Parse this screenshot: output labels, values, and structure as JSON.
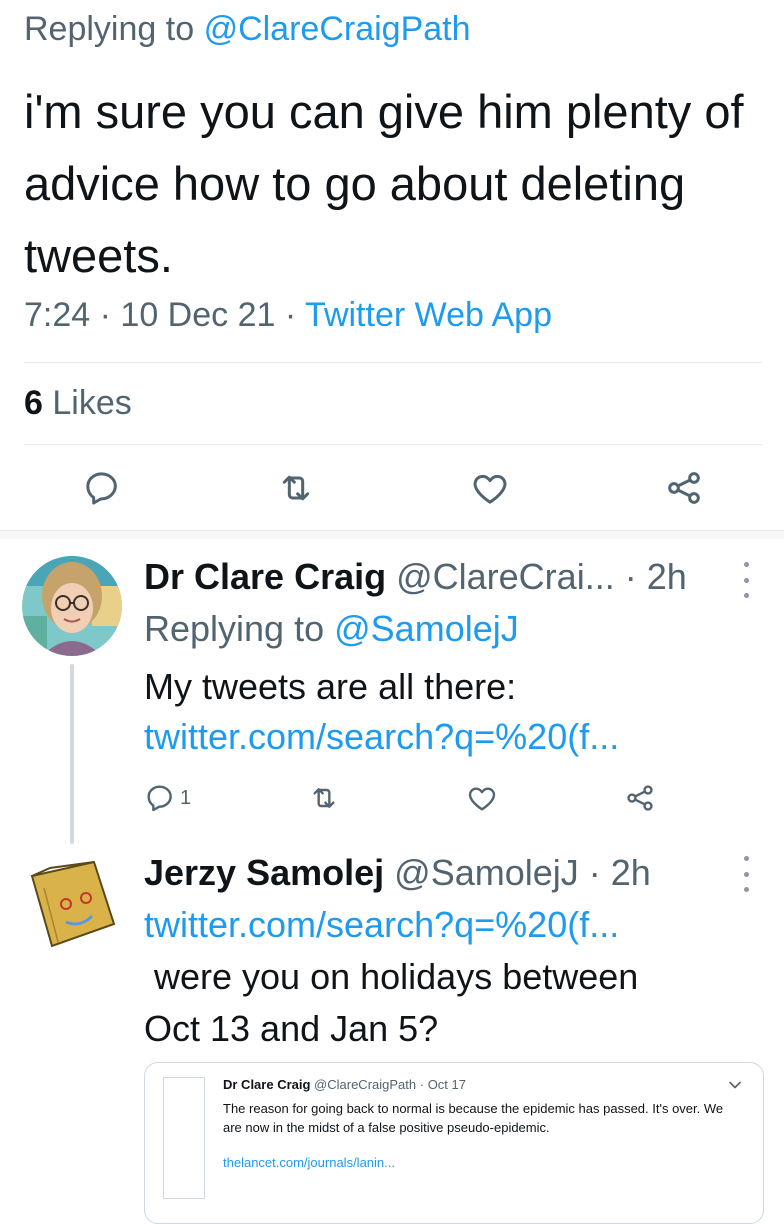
{
  "main_tweet": {
    "replying_prefix": "Replying to",
    "replying_handle": "@ClareCraigPath",
    "text": "i'm sure you can give him plenty of advice how to go about deleting tweets.",
    "time": "7:24",
    "date": "10 Dec 21",
    "source": "Twitter Web App",
    "likes_count": "6",
    "likes_label": "Likes"
  },
  "replies": [
    {
      "display_name": "Dr Clare Craig",
      "handle": "@ClareCrai...",
      "time": "· 2h",
      "replying_prefix": "Replying to",
      "replying_handle": "@SamolejJ",
      "text": "My tweets are all there:",
      "link": "twitter.com/search?q=%20(f...",
      "reply_count": "1"
    },
    {
      "display_name": "Jerzy Samolej",
      "handle": "@SamolejJ",
      "time": "· 2h",
      "link": "twitter.com/search?q=%20(f...",
      "text_line1": " were you on holidays between",
      "text_line2": "Oct 13 and Jan 5?"
    }
  ],
  "quoted_tweet": {
    "display_name": "Dr Clare Craig",
    "handle": "@ClareCraigPath",
    "date": "· Oct 17",
    "text": "The reason for going back to normal is because the epidemic has passed. It's over. We are now in the midst of a false positive pseudo-epidemic.",
    "link": "thelancet.com/journals/lanin..."
  },
  "colors": {
    "accent": "#1d9bf0",
    "muted": "#536471",
    "text": "#0f1419"
  },
  "icons": [
    "reply-icon",
    "retweet-icon",
    "like-icon",
    "share-icon",
    "more-icon",
    "chevron-down-icon"
  ]
}
